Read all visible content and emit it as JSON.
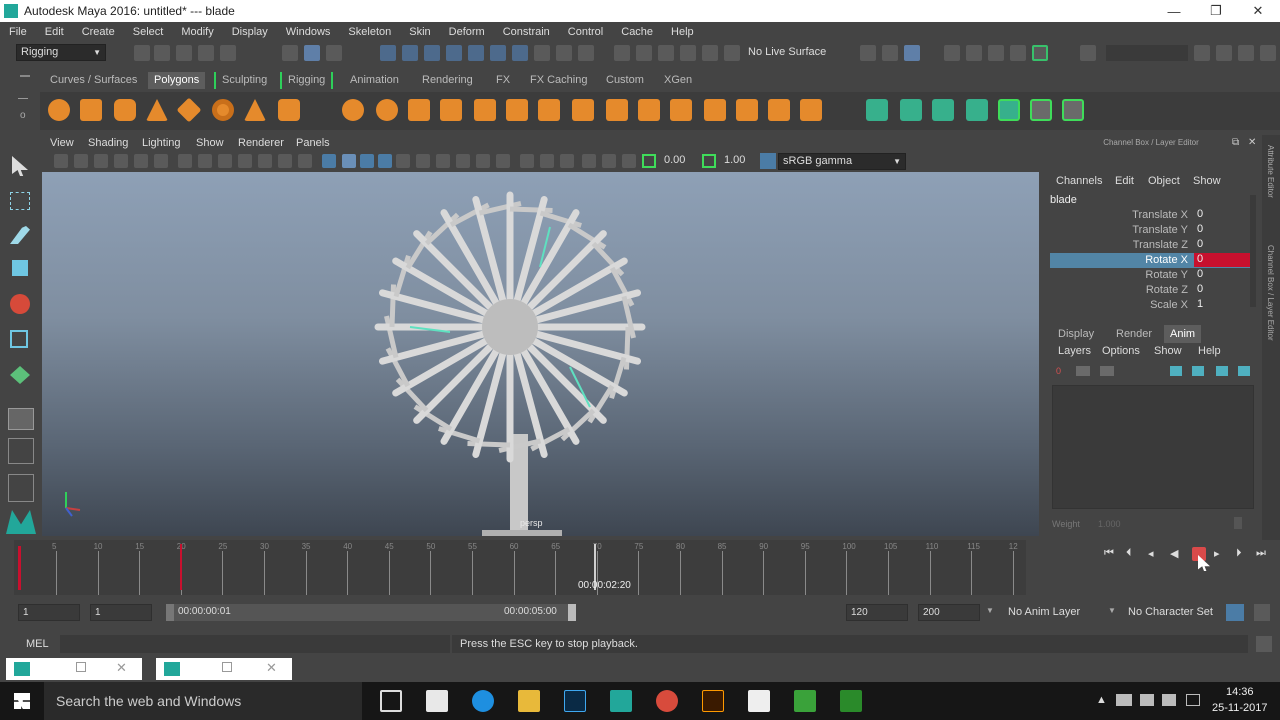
{
  "window": {
    "title": "Autodesk Maya 2016: untitled*   ---   blade",
    "minimize": "—",
    "restore": "❐",
    "close": "✕"
  },
  "menubar": [
    "File",
    "Edit",
    "Create",
    "Select",
    "Modify",
    "Display",
    "Windows",
    "Skeleton",
    "Skin",
    "Deform",
    "Constrain",
    "Control",
    "Cache",
    "Help"
  ],
  "statusline": {
    "mode": "Rigging",
    "live_surface": "No Live Surface"
  },
  "shelf_tabs": {
    "items": [
      "Curves / Surfaces",
      "Polygons",
      "Sculpting",
      "Rigging",
      "Animation",
      "Rendering",
      "FX",
      "FX Caching",
      "Custom",
      "XGen"
    ],
    "active": "Polygons"
  },
  "panel": {
    "menus": [
      "View",
      "Shading",
      "Lighting",
      "Show",
      "Renderer",
      "Panels"
    ],
    "value1": "0.00",
    "value2": "1.00",
    "colorspace": "sRGB gamma",
    "camera_label": "persp"
  },
  "channel_box": {
    "title": "Channel Box / Layer Editor",
    "menus": [
      "Channels",
      "Edit",
      "Object",
      "Show"
    ],
    "object": "blade",
    "attributes": [
      {
        "label": "Translate X",
        "value": "0"
      },
      {
        "label": "Translate Y",
        "value": "0"
      },
      {
        "label": "Translate Z",
        "value": "0"
      },
      {
        "label": "Rotate X",
        "value": "0"
      },
      {
        "label": "Rotate Y",
        "value": "0"
      },
      {
        "label": "Rotate Z",
        "value": "0"
      },
      {
        "label": "Scale X",
        "value": "1"
      }
    ],
    "selected_attribute": "Rotate X",
    "layer_tabs": [
      "Display",
      "Render",
      "Anim"
    ],
    "active_layer_tab": "Anim",
    "layer_menus": [
      "Layers",
      "Options",
      "Show",
      "Help"
    ],
    "weight_label": "Weight",
    "weight_value": "1.000"
  },
  "side_strips": {
    "attribute_editor": "Attribute Editor",
    "channel_box": "Channel Box / Layer Editor"
  },
  "time_slider": {
    "ticks": [
      "5",
      "10",
      "15",
      "20",
      "25",
      "30",
      "35",
      "40",
      "45",
      "50",
      "55",
      "60",
      "65",
      "70",
      "75",
      "80",
      "85",
      "90",
      "95",
      "100",
      "105",
      "110",
      "115",
      "12"
    ],
    "current_time": "00:00:02:20"
  },
  "range_slider": {
    "start_frame": "1",
    "current_start": "1",
    "range_start": "00:00:00:01",
    "range_end": "00:00:05:00",
    "end_frame": "120",
    "max_frame": "200",
    "anim_layer": "No Anim Layer",
    "character_set": "No Character Set"
  },
  "command_line": {
    "language": "MEL",
    "help_message": "Press the ESC key to stop playback."
  },
  "taskbar": {
    "search_placeholder": "Search the web and Windows",
    "time": "14:36",
    "date": "25-11-2017"
  },
  "colors": {
    "maya_teal": "#22a79a",
    "selected_attr_bg": "#5285a6",
    "keyed_red": "#c8102e",
    "active_tab_bg": "#5d5d5d"
  }
}
